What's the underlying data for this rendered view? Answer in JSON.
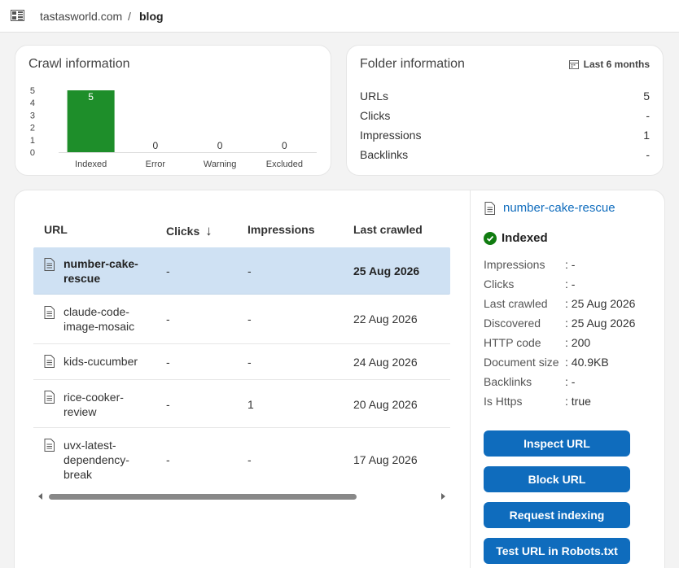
{
  "breadcrumb": {
    "site": "tastasworld.com",
    "separator": "/",
    "folder": "blog"
  },
  "crawl": {
    "title": "Crawl information",
    "chart_data": {
      "type": "bar",
      "categories": [
        "Indexed",
        "Error",
        "Warning",
        "Excluded"
      ],
      "values": [
        5,
        0,
        0,
        0
      ],
      "yticks": [
        0,
        1,
        2,
        3,
        4,
        5
      ],
      "ylim": [
        0,
        5
      ],
      "color": "#1e8e2a"
    }
  },
  "folder": {
    "title": "Folder information",
    "range": "Last 6 months",
    "rows": [
      {
        "label": "URLs",
        "value": "5"
      },
      {
        "label": "Clicks",
        "value": "-"
      },
      {
        "label": "Impressions",
        "value": "1"
      },
      {
        "label": "Backlinks",
        "value": "-"
      }
    ]
  },
  "table": {
    "headers": {
      "url": "URL",
      "clicks": "Clicks",
      "clicks_sort": "↓",
      "impressions": "Impressions",
      "last_crawled": "Last crawled"
    },
    "rows": [
      {
        "url": "number-cake-rescue",
        "url_lines": [
          "number-cake-",
          "rescue"
        ],
        "clicks": "-",
        "impressions": "-",
        "last_crawled": "25 Aug 2026"
      },
      {
        "url": "claude-code-image-mosaic",
        "url_lines": [
          "claude-code-",
          "image-mosaic"
        ],
        "clicks": "-",
        "impressions": "-",
        "last_crawled": "22 Aug 2026"
      },
      {
        "url": "kids-cucumber",
        "url_lines": [
          "kids-cucumber"
        ],
        "clicks": "-",
        "impressions": "-",
        "last_crawled": "24 Aug 2026"
      },
      {
        "url": "rice-cooker-review",
        "url_lines": [
          "rice-cooker-",
          "review"
        ],
        "clicks": "-",
        "impressions": "1",
        "last_crawled": "20 Aug 2026"
      },
      {
        "url": "uvx-latest-dependency-break",
        "url_lines": [
          "uvx-latest-",
          "dependency-",
          "break"
        ],
        "clicks": "-",
        "impressions": "-",
        "last_crawled": "17 Aug 2026"
      }
    ]
  },
  "detail": {
    "title": "number-cake-rescue",
    "status": "Indexed",
    "status_color": "#107c10",
    "rows": [
      {
        "label": "Impressions",
        "value": ": -"
      },
      {
        "label": "Clicks",
        "value": ": -"
      },
      {
        "label": "Last crawled",
        "value": ": 25 Aug 2026"
      },
      {
        "label": "Discovered",
        "value": ": 25 Aug 2026"
      },
      {
        "label": "HTTP code",
        "value": ": 200"
      },
      {
        "label": "Document size",
        "value": ": 40.9KB"
      },
      {
        "label": "Backlinks",
        "value": ": -"
      },
      {
        "label": "Is Https",
        "value": ": true"
      }
    ],
    "buttons": {
      "inspect": "Inspect URL",
      "block": "Block URL",
      "request": "Request indexing",
      "robots": "Test URL in Robots.txt"
    }
  },
  "accent": "#0f6cbd"
}
